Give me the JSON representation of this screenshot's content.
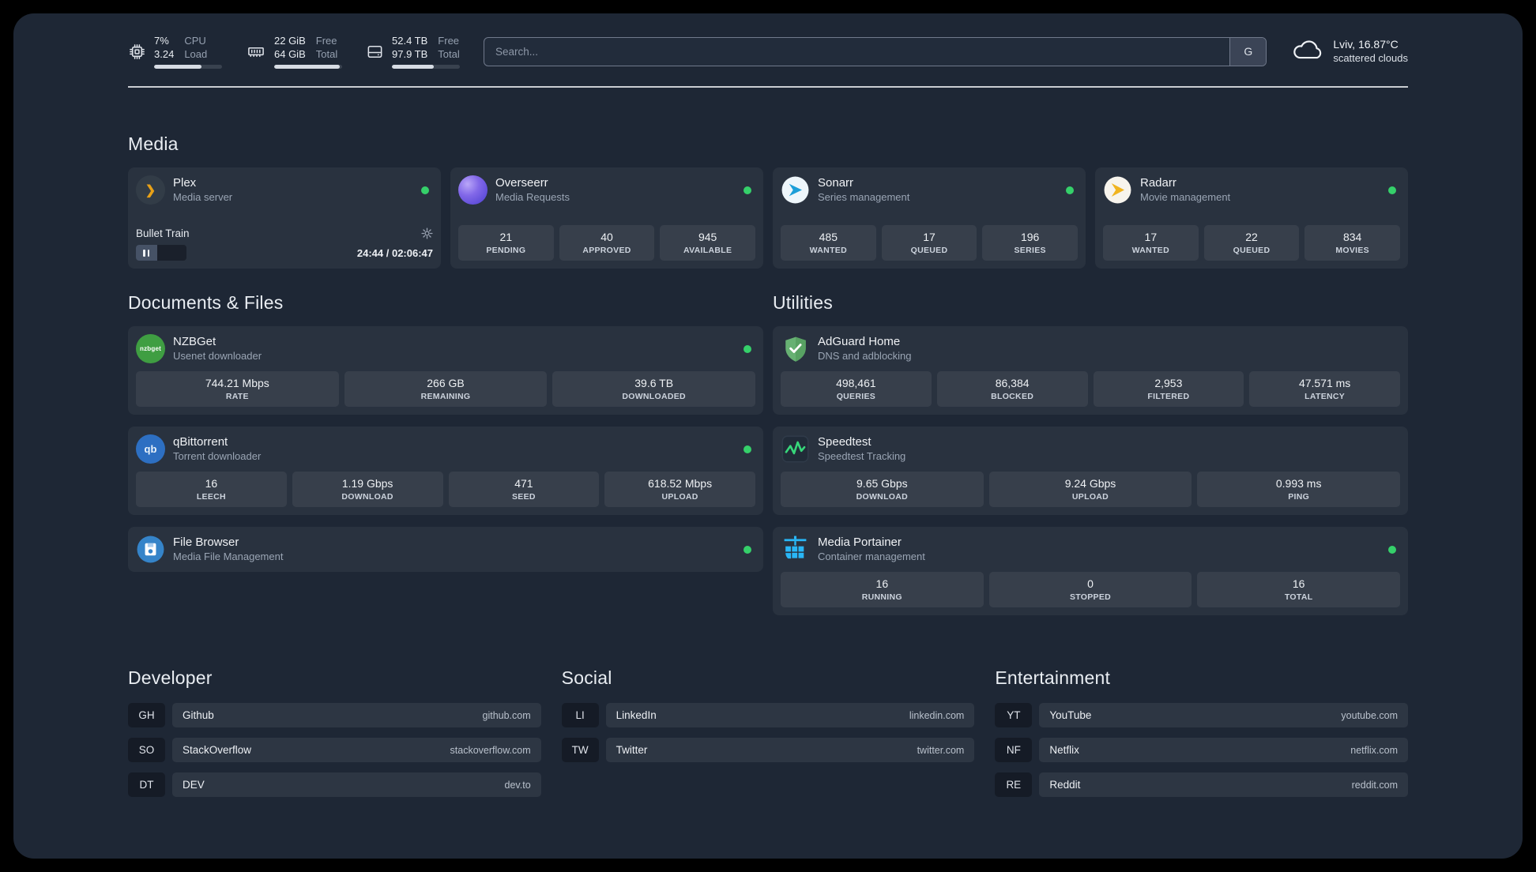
{
  "colors": {
    "background": "#1e2735",
    "status_green": "#35d06a",
    "adguard_green": "#67b173",
    "portainer_blue": "#29b6f6",
    "plex_gold": "#e8a117",
    "sonarr_blue": "#1b9ed8",
    "radarr_gold": "#f0b41f",
    "overseerr_purple": "#8268e8",
    "qbittorrent_blue": "#2d6fc2",
    "nzbget_green": "#3f9e42",
    "filebrowser_blue": "#3584c9",
    "speedtest_green": "#37d67a"
  },
  "icons": {
    "plex_glyph": "❯",
    "nzbget_glyph": "nzbget",
    "qbittorrent_glyph": "qb"
  },
  "topbar": {
    "cpu": {
      "value1": "7%",
      "value2": "3.24",
      "label1": "CPU",
      "label2": "Load",
      "progress_percent": 70
    },
    "ram": {
      "value1": "22 GiB",
      "value2": "64 GiB",
      "label1": "Free",
      "label2": "Total",
      "progress_percent": 97
    },
    "disk": {
      "value1": "52.4 TB",
      "value2": "97.9 TB",
      "label1": "Free",
      "label2": "Total",
      "progress_percent": 62
    },
    "search": {
      "placeholder": "Search...",
      "button_label": "G"
    },
    "weather": {
      "location": "Lviv, 16.87°C",
      "condition": "scattered clouds"
    }
  },
  "media": {
    "heading": "Media",
    "plex": {
      "title": "Plex",
      "subtitle": "Media server",
      "now_playing": "Bullet Train",
      "time": "24:44 / 02:06:47",
      "progress_percent": 42
    },
    "overseerr": {
      "title": "Overseerr",
      "subtitle": "Media Requests",
      "stats": [
        {
          "value": "21",
          "label": "PENDING"
        },
        {
          "value": "40",
          "label": "APPROVED"
        },
        {
          "value": "945",
          "label": "AVAILABLE"
        }
      ]
    },
    "sonarr": {
      "title": "Sonarr",
      "subtitle": "Series management",
      "stats": [
        {
          "value": "485",
          "label": "WANTED"
        },
        {
          "value": "17",
          "label": "QUEUED"
        },
        {
          "value": "196",
          "label": "SERIES"
        }
      ]
    },
    "radarr": {
      "title": "Radarr",
      "subtitle": "Movie management",
      "stats": [
        {
          "value": "17",
          "label": "WANTED"
        },
        {
          "value": "22",
          "label": "QUEUED"
        },
        {
          "value": "834",
          "label": "MOVIES"
        }
      ]
    }
  },
  "documents": {
    "heading": "Documents & Files",
    "nzbget": {
      "title": "NZBGet",
      "subtitle": "Usenet downloader",
      "stats": [
        {
          "value": "744.21 Mbps",
          "label": "RATE"
        },
        {
          "value": "266 GB",
          "label": "REMAINING"
        },
        {
          "value": "39.6 TB",
          "label": "DOWNLOADED"
        }
      ]
    },
    "qbittorrent": {
      "title": "qBittorrent",
      "subtitle": "Torrent downloader",
      "stats": [
        {
          "value": "16",
          "label": "LEECH"
        },
        {
          "value": "1.19 Gbps",
          "label": "DOWNLOAD"
        },
        {
          "value": "471",
          "label": "SEED"
        },
        {
          "value": "618.52 Mbps",
          "label": "UPLOAD"
        }
      ]
    },
    "filebrowser": {
      "title": "File Browser",
      "subtitle": "Media File Management"
    }
  },
  "utilities": {
    "heading": "Utilities",
    "adguard": {
      "title": "AdGuard Home",
      "subtitle": "DNS and adblocking",
      "stats": [
        {
          "value": "498,461",
          "label": "QUERIES"
        },
        {
          "value": "86,384",
          "label": "BLOCKED"
        },
        {
          "value": "2,953",
          "label": "FILTERED"
        },
        {
          "value": "47.571 ms",
          "label": "LATENCY"
        }
      ]
    },
    "speedtest": {
      "title": "Speedtest",
      "subtitle": "Speedtest Tracking",
      "stats": [
        {
          "value": "9.65 Gbps",
          "label": "DOWNLOAD"
        },
        {
          "value": "9.24 Gbps",
          "label": "UPLOAD"
        },
        {
          "value": "0.993 ms",
          "label": "PING"
        }
      ]
    },
    "portainer": {
      "title": "Media Portainer",
      "subtitle": "Container management",
      "stats": [
        {
          "value": "16",
          "label": "RUNNING"
        },
        {
          "value": "0",
          "label": "STOPPED"
        },
        {
          "value": "16",
          "label": "TOTAL"
        }
      ]
    }
  },
  "bookmarks": {
    "developer": {
      "heading": "Developer",
      "items": [
        {
          "abbr": "GH",
          "name": "Github",
          "url": "github.com"
        },
        {
          "abbr": "SO",
          "name": "StackOverflow",
          "url": "stackoverflow.com"
        },
        {
          "abbr": "DT",
          "name": "DEV",
          "url": "dev.to"
        }
      ]
    },
    "social": {
      "heading": "Social",
      "items": [
        {
          "abbr": "LI",
          "name": "LinkedIn",
          "url": "linkedin.com"
        },
        {
          "abbr": "TW",
          "name": "Twitter",
          "url": "twitter.com"
        }
      ]
    },
    "entertainment": {
      "heading": "Entertainment",
      "items": [
        {
          "abbr": "YT",
          "name": "YouTube",
          "url": "youtube.com"
        },
        {
          "abbr": "NF",
          "name": "Netflix",
          "url": "netflix.com"
        },
        {
          "abbr": "RE",
          "name": "Reddit",
          "url": "reddit.com"
        }
      ]
    }
  }
}
